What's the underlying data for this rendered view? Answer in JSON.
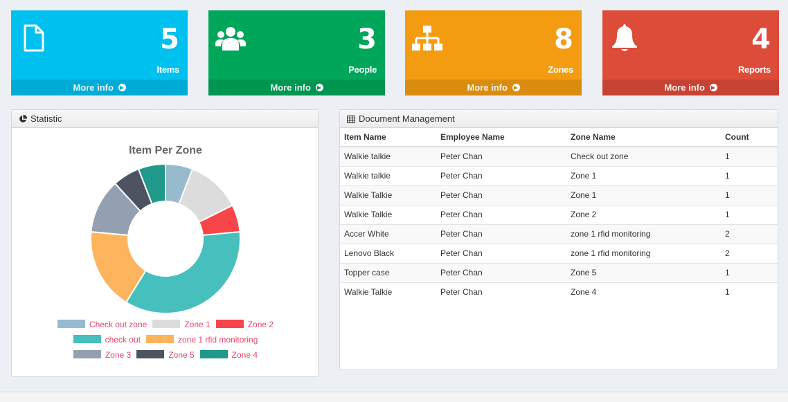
{
  "boxes": [
    {
      "number": "5",
      "label": "Items",
      "footer": "More info",
      "icon": "document-icon",
      "color": "#00c0ef",
      "footer_color": "#00acd6"
    },
    {
      "number": "3",
      "label": "People",
      "footer": "More info",
      "icon": "users-icon",
      "color": "#00a65a",
      "footer_color": "#009551"
    },
    {
      "number": "8",
      "label": "Zones",
      "footer": "More info",
      "icon": "sitemap-icon",
      "color": "#f39c12",
      "footer_color": "#da8c10"
    },
    {
      "number": "4",
      "label": "Reports",
      "footer": "More info",
      "icon": "bell-icon",
      "color": "#dd4b39",
      "footer_color": "#c64333"
    }
  ],
  "statistic": {
    "title": "Statistic",
    "icon": "pie-chart-icon"
  },
  "chart_data": {
    "type": "pie",
    "title": "Item Per Zone",
    "donut": true,
    "categories": [
      "Check out zone",
      "Zone 1",
      "Zone 2",
      "check out",
      "zone 1 rfid monitoring",
      "Zone 3",
      "Zone 5",
      "Zone 4"
    ],
    "values": [
      1,
      2,
      1,
      6,
      3,
      2,
      1,
      1
    ],
    "colors": [
      "#97bbcd",
      "#dcdcdc",
      "#f7464a",
      "#46bfbd",
      "#fdb45c",
      "#949fb1",
      "#4d5360",
      "#20998a"
    ],
    "legend_rows": [
      [
        0,
        1,
        2
      ],
      [
        3,
        4
      ],
      [
        5,
        6,
        7
      ]
    ],
    "legend_position": "bottom"
  },
  "documents": {
    "title": "Document Management",
    "icon": "table-icon",
    "columns": [
      "Item Name",
      "Employee Name",
      "Zone Name",
      "Count"
    ],
    "rows": [
      [
        "Walkie talkie",
        "Peter Chan",
        "Check out zone",
        "1"
      ],
      [
        "Walkie talkie",
        "Peter Chan",
        "Zone 1",
        "1"
      ],
      [
        "Walkie Talkie",
        "Peter Chan",
        "Zone 1",
        "1"
      ],
      [
        "Walkie Talkie",
        "Peter Chan",
        "Zone 2",
        "1"
      ],
      [
        "Accer White",
        "Peter Chan",
        "zone 1 rfid monitoring",
        "2"
      ],
      [
        "Lenovo Black",
        "Peter Chan",
        "zone 1 rfid monitoring",
        "2"
      ],
      [
        "Topper case",
        "Peter Chan",
        "Zone 5",
        "1"
      ],
      [
        "Walkie Talkie",
        "Peter Chan",
        "Zone 4",
        "1"
      ]
    ]
  }
}
